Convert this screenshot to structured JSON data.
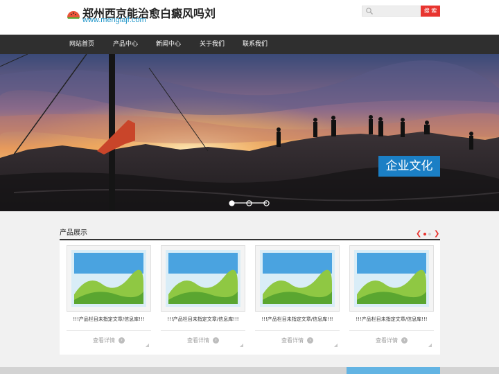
{
  "header": {
    "title": "郑州西京能治愈白癜风吗刘",
    "url": "www.menglajf.com",
    "logo_icon": "watermelon-logo-icon"
  },
  "search": {
    "placeholder": "",
    "button_label": "搜 索",
    "icon": "search-icon"
  },
  "nav": {
    "items": [
      {
        "label": "网站首页"
      },
      {
        "label": "产品中心"
      },
      {
        "label": "新闻中心"
      },
      {
        "label": "关于我们"
      },
      {
        "label": "联系我们"
      }
    ]
  },
  "banner": {
    "caption": "企业文化",
    "slides_count": 3,
    "active_slide": 1
  },
  "products": {
    "section_title": "产品展示",
    "items": [
      {
        "title": "!!!产品栏目未指定文章/信息库!!!",
        "more_label": "查看详情"
      },
      {
        "title": "!!!产品栏目未指定文章/信息库!!!",
        "more_label": "查看详情"
      },
      {
        "title": "!!!产品栏目未指定文章/信息库!!!",
        "more_label": "查看详情"
      },
      {
        "title": "!!!产品栏目未指定文章/信息库!!!",
        "more_label": "查看详情"
      }
    ],
    "pager": {
      "pages": 2,
      "active": 1
    }
  },
  "colors": {
    "accent_red": "#e8342f",
    "accent_blue": "#1b7fc5",
    "nav_bg": "#2f2f2f",
    "url_color": "#1b93c7"
  }
}
